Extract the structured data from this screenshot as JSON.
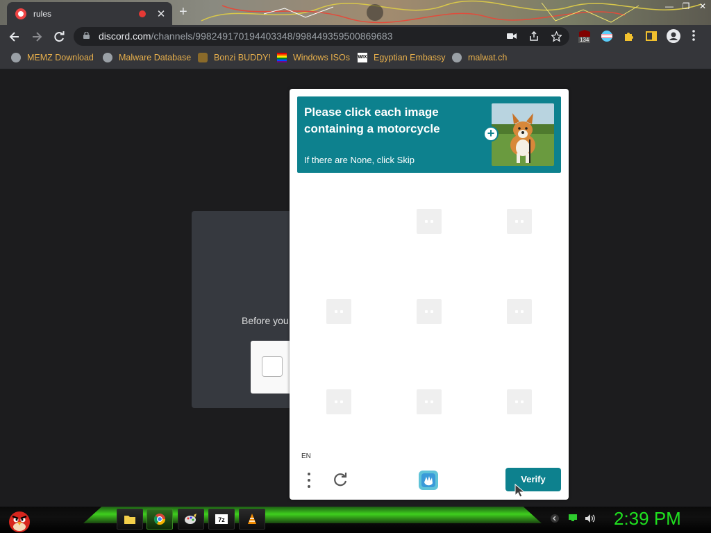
{
  "browser": {
    "tab_title": "rules",
    "tab_close": "✕",
    "new_tab": "+",
    "window_controls": [
      "—",
      "❐",
      "✕"
    ],
    "url_domain": "discord.com",
    "url_path": "/channels/998249170194403348/998449359500869683",
    "extension_badge": "134"
  },
  "bookmarks": [
    {
      "label": "MEMZ Download",
      "icon": "globe-icon"
    },
    {
      "label": "Malware Database",
      "icon": "globe-icon"
    },
    {
      "label": "Bonzi BUDDY!",
      "icon": "bonzi-icon"
    },
    {
      "label": "Windows ISOs",
      "icon": "windows-flag-icon"
    },
    {
      "label": "Egyptian Embassy",
      "icon": "wix-icon"
    },
    {
      "label": "malwat.ch",
      "icon": "globe-icon"
    }
  ],
  "page": {
    "before_text": "Before you"
  },
  "captcha": {
    "title": "Please click each image containing a motorcycle",
    "subtitle": "If there are None, click Skip",
    "lang": "EN",
    "verify_label": "Verify",
    "accent": "#0d818e",
    "cells": 9
  },
  "taskbar": {
    "clock": "2:39 PM",
    "apps": [
      "file-explorer-icon",
      "chrome-icon",
      "paint-icon",
      "7zip-icon",
      "vlc-icon"
    ]
  }
}
